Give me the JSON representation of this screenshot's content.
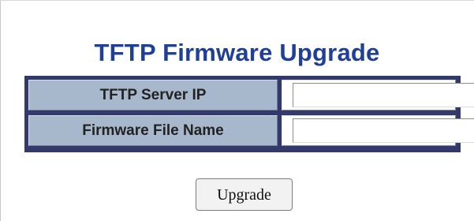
{
  "page": {
    "title": "TFTP Firmware Upgrade"
  },
  "form": {
    "server_ip_label": "TFTP Server IP",
    "server_ip_value": "",
    "file_name_label": "Firmware File Name",
    "file_name_value": ""
  },
  "actions": {
    "upgrade_label": "Upgrade"
  },
  "colors": {
    "title": "#1f3f99",
    "table_border": "#333a6b",
    "label_cell": "#a8b8cc",
    "input_cell": "#ffffff"
  }
}
